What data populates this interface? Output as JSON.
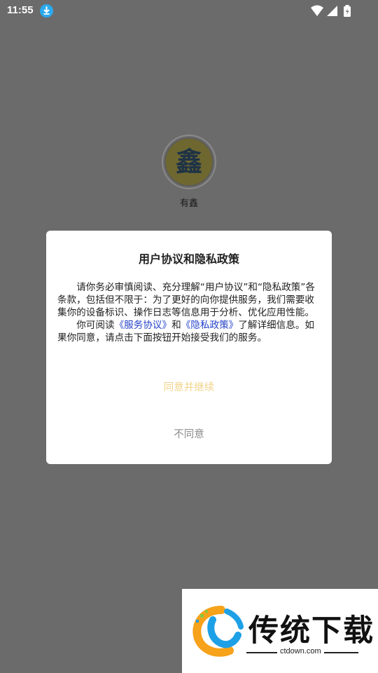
{
  "status_bar": {
    "time": "11:55",
    "icons": [
      "download-icon",
      "wifi-icon",
      "signal-icon",
      "battery-charging-icon"
    ]
  },
  "app": {
    "logo_glyph": "鑫",
    "name": "有鑫"
  },
  "dialog": {
    "title": "用户协议和隐私政策",
    "para1": "请你务必审慎阅读、充分理解“用户协议”和“隐私政策”各条款，包括但不限于：为了更好的向你提供服务，我们需要收集你的设备标识、操作日志等信息用于分析、优化应用性能。",
    "para2_prefix": "你可阅读",
    "service_link": "《服务协议》",
    "and_text": "和",
    "privacy_link": "《隐私政策》",
    "para2_suffix": "了解详细信息。如果你同意，请点击下面按钮开始接受我们的服务。",
    "agree_label": "同意并继续",
    "disagree_label": "不同意"
  },
  "watermark": {
    "brand": "传统下载",
    "url": "ctdown.com"
  },
  "colors": {
    "overlay": "#6b6b6b",
    "link": "#2643c9",
    "agree": "#f1d48a",
    "disagree": "#8b8b8b",
    "download_badge": "#2aa9f0"
  }
}
